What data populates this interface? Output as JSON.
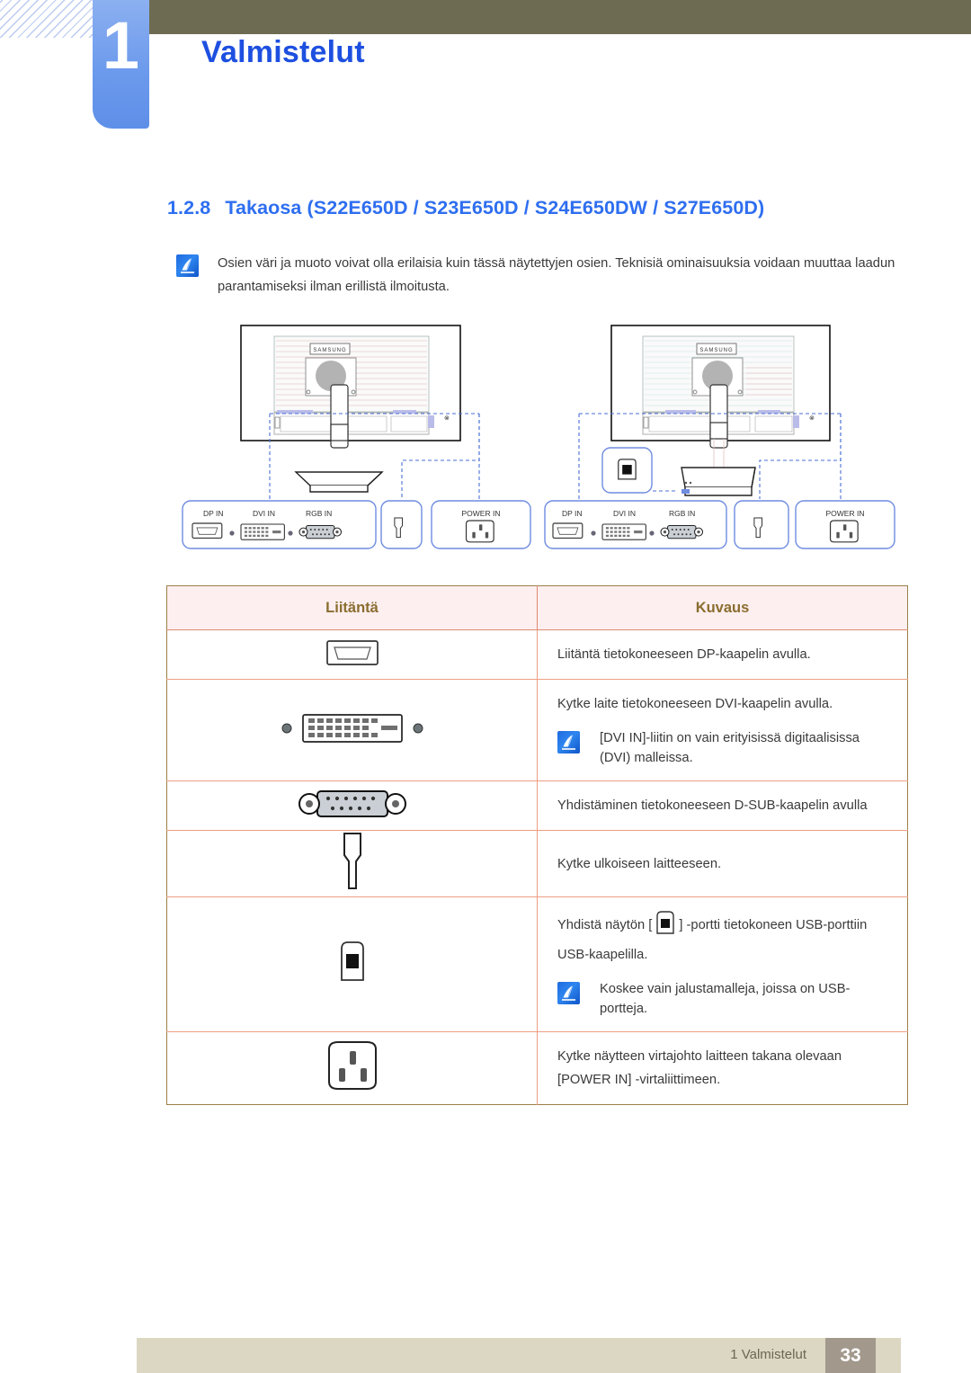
{
  "header": {
    "chapter_number": "1",
    "chapter_title": "Valmistelut"
  },
  "section": {
    "number": "1.2.8",
    "title": "Takaosa (S22E650D / S23E650D / S24E650DW / S27E650D)"
  },
  "note": {
    "icon": "note-pen-icon",
    "text": "Osien väri ja muoto voivat olla erilaisia kuin tässä näytettyjen osien. Teknisiä ominaisuuksia voidaan muuttaa laadun parantamiseksi ilman erillistä ilmoitusta."
  },
  "diagram": {
    "left_monitor": {
      "brand_label": "SAMSUNG",
      "callouts": [
        {
          "label": "DP IN",
          "icon": "displayport-icon"
        },
        {
          "label": "DVI IN",
          "icon": "dvi-icon"
        },
        {
          "label": "RGB IN",
          "icon": "vga-icon"
        },
        {
          "label": "",
          "icon": "audio-jack-icon"
        },
        {
          "label": "POWER IN",
          "icon": "power-socket-icon"
        }
      ]
    },
    "right_monitor": {
      "brand_label": "SAMSUNG",
      "usb_callout": {
        "label": "",
        "icon": "usb-b-icon"
      },
      "callouts": [
        {
          "label": "DP IN",
          "icon": "displayport-icon"
        },
        {
          "label": "DVI IN",
          "icon": "dvi-icon"
        },
        {
          "label": "RGB IN",
          "icon": "vga-icon"
        },
        {
          "label": "",
          "icon": "audio-jack-icon"
        },
        {
          "label": "POWER IN",
          "icon": "power-socket-icon"
        }
      ]
    }
  },
  "table": {
    "headers": [
      "Liitäntä",
      "Kuvaus"
    ],
    "rows": [
      {
        "icon": "displayport-icon",
        "description": "Liitäntä tietokoneeseen DP-kaapelin avulla.",
        "sub_note": null
      },
      {
        "icon": "dvi-icon",
        "description": "Kytke laite tietokoneeseen DVI-kaapelin avulla.",
        "sub_note": "[DVI IN]-liitin on vain erityisissä digitaalisissa (DVI) malleissa."
      },
      {
        "icon": "vga-icon",
        "description": "Yhdistäminen tietokoneeseen D-SUB-kaapelin avulla",
        "sub_note": null
      },
      {
        "icon": "audio-jack-icon",
        "description": "Kytke ulkoiseen laitteeseen.",
        "sub_note": null
      },
      {
        "icon": "usb-b-icon",
        "description_before": "Yhdistä näytön [",
        "description_after": "] -portti tietokoneen USB-porttiin USB-kaapelilla.",
        "sub_note": "Koskee vain jalustamalleja, joissa on USB-portteja."
      },
      {
        "icon": "power-socket-icon",
        "description": "Kytke näytteen virtajohto laitteen takana olevaan [POWER IN] -virtaliittimeen.",
        "sub_note": null
      }
    ]
  },
  "footer": {
    "label": "1 Valmistelut",
    "page": "33"
  },
  "colors": {
    "chapter_blue": "#6c9aec",
    "heading_blue": "#2e6ef0",
    "olive_bar": "#6e6b53",
    "table_header_bg": "#fdeff0",
    "table_header_text": "#8a6d2f",
    "table_border": "#9c7f46",
    "table_row_divider": "#ef9e84",
    "callout_blue": "#6e8ce0",
    "footer_bg": "#dbd7c2",
    "footer_page_bg": "#a2988c"
  }
}
